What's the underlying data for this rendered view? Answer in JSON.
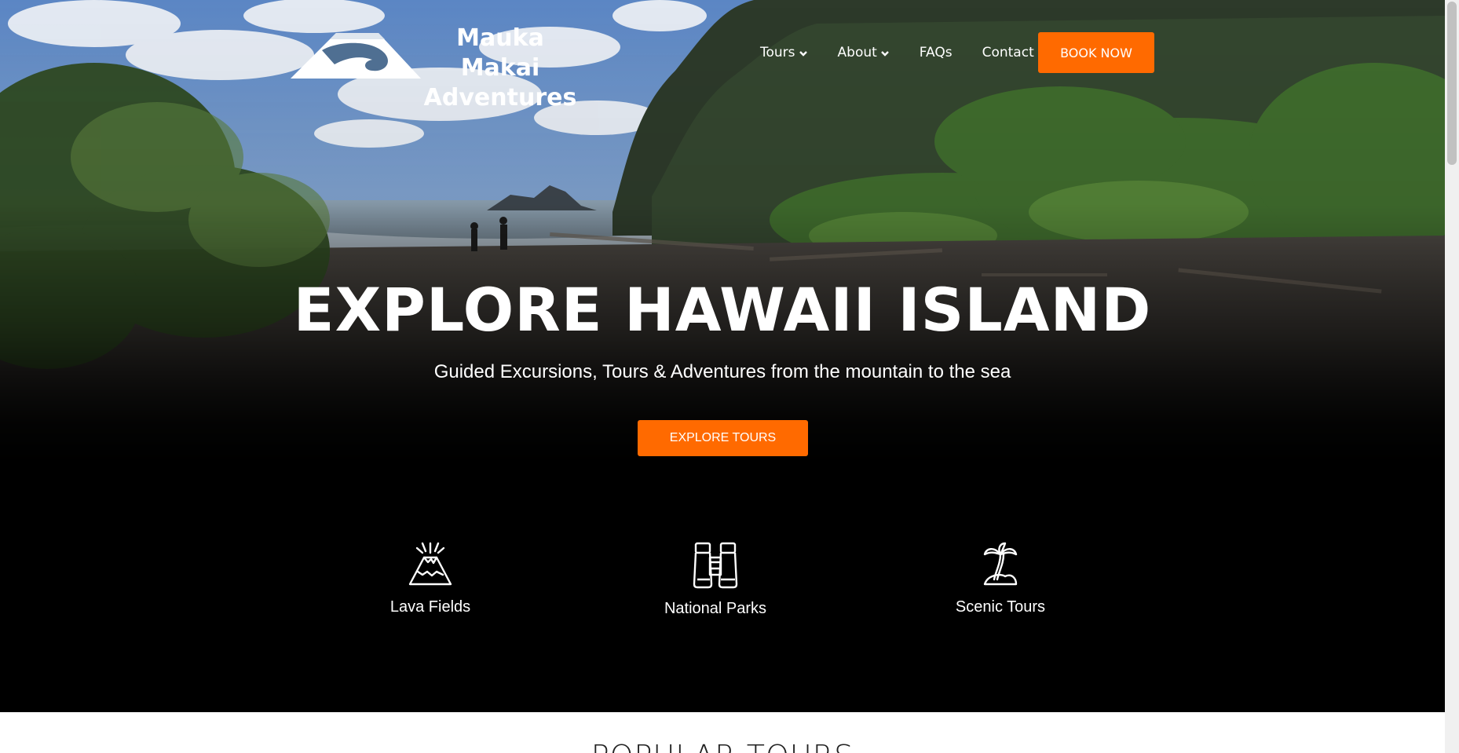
{
  "brand": {
    "name_line1": "Mauka Makai",
    "name_line2": "Adventures"
  },
  "nav": {
    "items": [
      {
        "label": "Tours",
        "has_dropdown": true
      },
      {
        "label": "About",
        "has_dropdown": true
      },
      {
        "label": "FAQs",
        "has_dropdown": false
      },
      {
        "label": "Contact",
        "has_dropdown": false
      }
    ],
    "cta_label": "BOOK NOW"
  },
  "hero": {
    "title": "EXPLORE HAWAII ISLAND",
    "subtitle": "Guided Excursions, Tours & Adventures from the mountain to the sea",
    "button_label": "EXPLORE TOURS"
  },
  "features": [
    {
      "label": "Lava Fields",
      "icon": "volcano-icon"
    },
    {
      "label": "National Parks",
      "icon": "binoculars-icon"
    },
    {
      "label": "Scenic Tours",
      "icon": "palm-island-icon"
    }
  ],
  "popular": {
    "title": "POPULAR TOURS"
  },
  "colors": {
    "accent": "#ff6a00",
    "hero_dark": "#000000",
    "text_light": "#ffffff"
  }
}
